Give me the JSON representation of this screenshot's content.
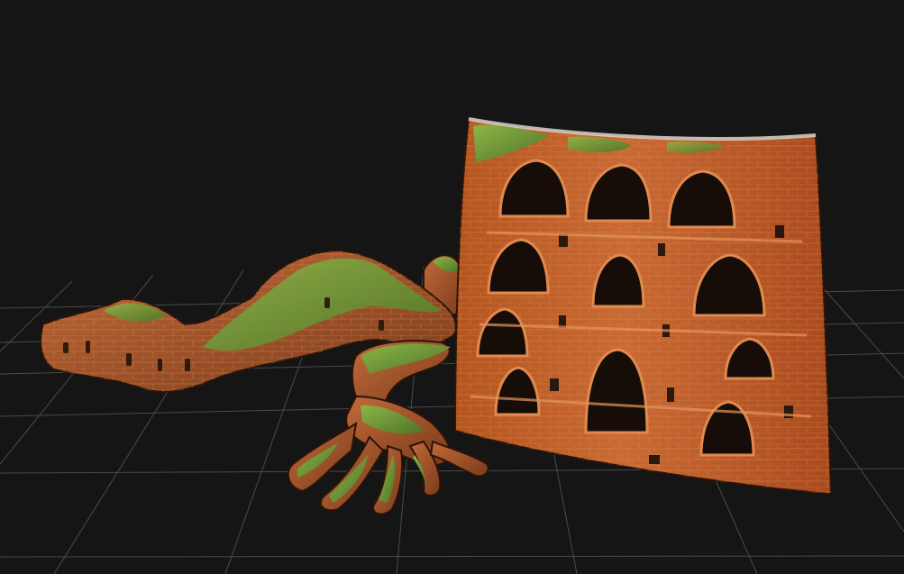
{
  "viewport": {
    "background_color": "#151515",
    "grid_color": "#4a4a4a",
    "grid": true
  },
  "objects": [
    {
      "name": "mossy-brick-hand-sculpture",
      "base_color": "#b85c2c",
      "moss_color": "#7aa33a",
      "highlight_color": "#d98850"
    },
    {
      "name": "curved-brick-wall-panel",
      "base_color": "#c4622e",
      "mortar_color": "#e08a4e",
      "shadow_color": "#1b120c",
      "moss_color": "#6f8f3a"
    }
  ]
}
